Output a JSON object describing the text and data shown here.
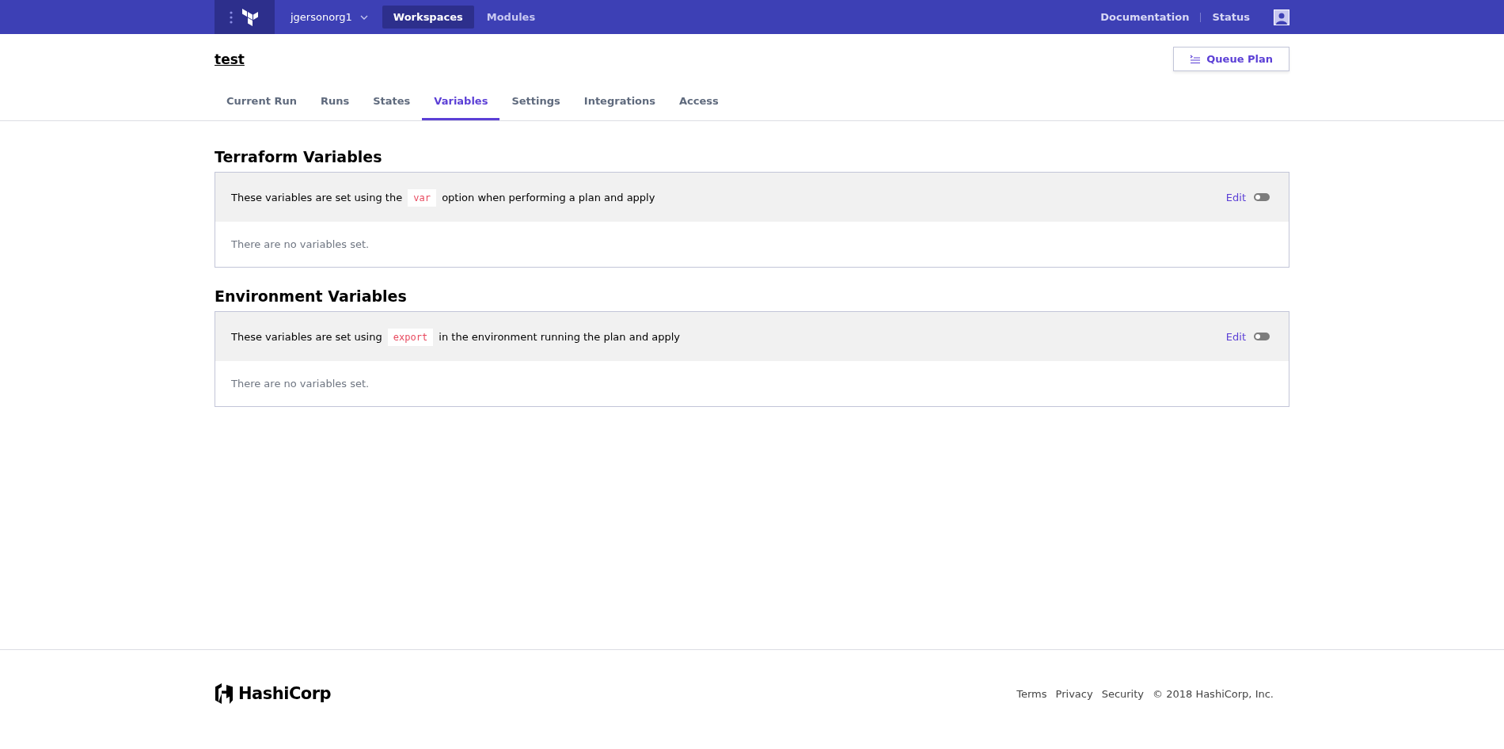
{
  "top_nav": {
    "org": "jgersonorg1",
    "items": [
      {
        "label": "Workspaces",
        "selected": true
      },
      {
        "label": "Modules",
        "selected": false
      }
    ],
    "links": [
      "Documentation",
      "Status"
    ]
  },
  "workspace": {
    "title": "test",
    "queue_button": "Queue Plan"
  },
  "tabs": [
    {
      "label": "Current Run",
      "selected": false
    },
    {
      "label": "Runs",
      "selected": false
    },
    {
      "label": "States",
      "selected": false
    },
    {
      "label": "Variables",
      "selected": true
    },
    {
      "label": "Settings",
      "selected": false
    },
    {
      "label": "Integrations",
      "selected": false
    },
    {
      "label": "Access",
      "selected": false
    }
  ],
  "sections": [
    {
      "heading": "Terraform Variables",
      "text_before": "These variables are set using the",
      "code": "var",
      "text_after": "option when performing a plan and apply",
      "edit": "Edit",
      "toggle_on": false,
      "empty_text": "There are no variables set."
    },
    {
      "heading": "Environment Variables",
      "text_before": "These variables are set using",
      "code": "export",
      "text_after": "in the environment running the plan and apply",
      "edit": "Edit",
      "toggle_on": false,
      "empty_text": "There are no variables set."
    }
  ],
  "footer": {
    "brand": "HashiCorp",
    "links": [
      "Terms",
      "Privacy",
      "Security"
    ],
    "copyright": "© 2018 HashiCorp, Inc."
  }
}
